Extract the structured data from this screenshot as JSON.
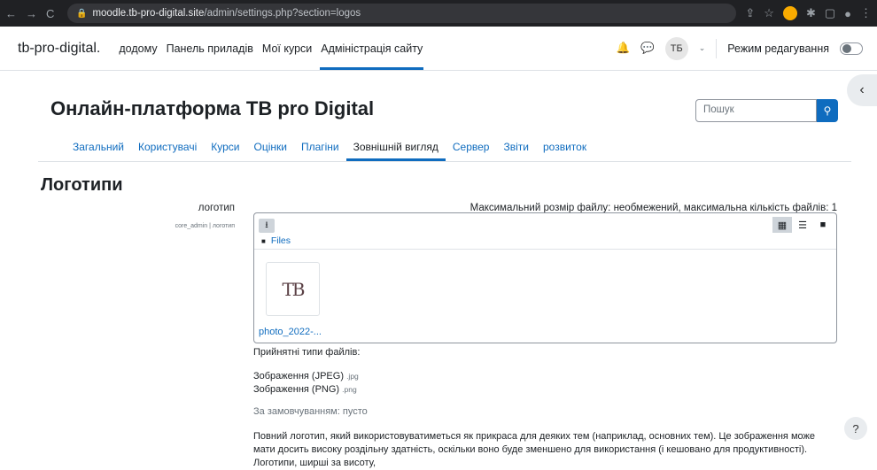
{
  "browser": {
    "url_host": "moodle.tb-pro-digital.site",
    "url_path": "/admin/settings.php?section=logos"
  },
  "topnav": {
    "brand": "tb-pro-digital.",
    "items": [
      "додому",
      "Панель приладів",
      "Мої курси",
      "Адміністрація сайту"
    ],
    "avatar_initials": "ТБ",
    "edit_mode_label": "Режим редагування"
  },
  "page": {
    "site_title": "Онлайн-платформа TB pro Digital",
    "search_placeholder": "Пошук",
    "tabs": [
      "Загальний",
      "Користувачі",
      "Курси",
      "Оцінки",
      "Плагіни",
      "Зовнішній вигляд",
      "Сервер",
      "Звіти",
      "розвиток"
    ],
    "heading": "Логотипи"
  },
  "setting": {
    "label": "логотип",
    "sublabel": "core_admin | логотип",
    "max_info": "Максимальний розмір файлу: необмежений, максимальна кількість файлів: 1",
    "path_label": "Files",
    "thumb_text": "TB",
    "file_name": "photo_2022-...",
    "accepted_title": "Прийнятні типи файлів:",
    "type1": "Зображення (JPEG)",
    "type1_ext": ".jpg",
    "type2": "Зображення (PNG)",
    "type2_ext": ".png",
    "default": "За замовчуванням: пусто",
    "description": "Повний логотип, який використовуватиметься як прикраса для деяких тем (наприклад, основних тем). Це зображення може мати досить високу роздільну здатність, оскільки воно буде зменшено для використання (і кешовано для продуктивності). Логотипи, ширші за висоту,"
  }
}
